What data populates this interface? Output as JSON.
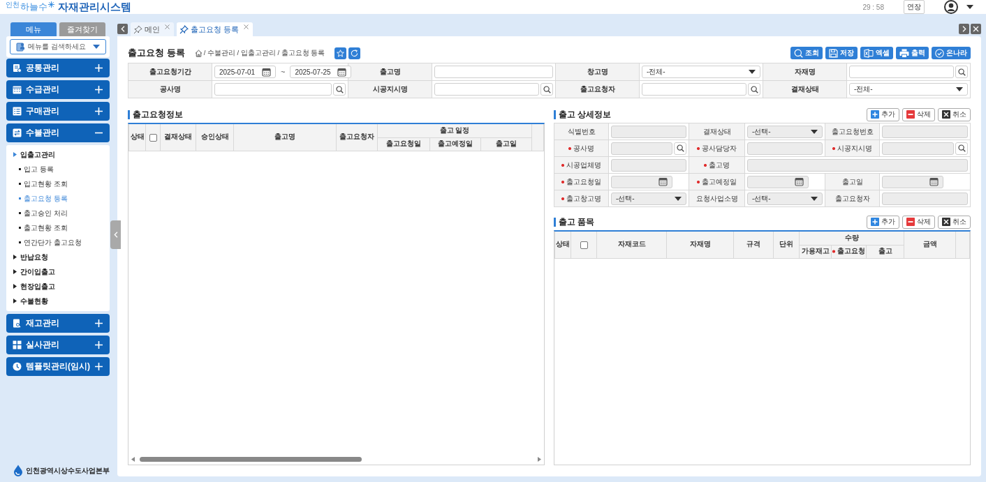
{
  "header": {
    "logo_prefix": "인천",
    "logo_brand": "하늘수",
    "system_title": "자재관리시스템",
    "timer": "29 : 58",
    "extend_button": "연장"
  },
  "sidebar": {
    "tabs": [
      {
        "label": "메뉴",
        "selected": true
      },
      {
        "label": "즐겨찾기",
        "selected": false
      }
    ],
    "search": {
      "placeholder": "메뉴를 검색하세요"
    },
    "menus": [
      {
        "label": "공통관리",
        "expanded": false
      },
      {
        "label": "수급관리",
        "expanded": false
      },
      {
        "label": "구매관리",
        "expanded": false
      },
      {
        "label": "수불관리",
        "expanded": true,
        "children": [
          {
            "label": "입출고관리",
            "expanded": true,
            "children": [
              {
                "label": "입고 등록",
                "selected": false
              },
              {
                "label": "입고현황 조회",
                "selected": false
              },
              {
                "label": "출고요청 등록",
                "selected": true
              },
              {
                "label": "출고승인 처리",
                "selected": false
              },
              {
                "label": "출고현황 조회",
                "selected": false
              },
              {
                "label": "연간단가 출고요청",
                "selected": false
              }
            ]
          },
          {
            "label": "반납요청",
            "expanded": false
          },
          {
            "label": "간이입출고",
            "expanded": false
          },
          {
            "label": "현장입출고",
            "expanded": false
          },
          {
            "label": "수불현황",
            "expanded": false
          }
        ]
      },
      {
        "label": "재고관리",
        "expanded": false
      },
      {
        "label": "실사관리",
        "expanded": false
      },
      {
        "label": "템플릿관리(임시)",
        "expanded": false
      }
    ],
    "footer": "인천광역시상수도사업본부"
  },
  "tabs": [
    {
      "label": "메인",
      "selected": false
    },
    {
      "label": "출고요청 등록",
      "selected": true
    }
  ],
  "page": {
    "title": "출고요청 등록",
    "breadcrumb": "/ 수불관리 / 입출고관리 / 출고요청 등록",
    "toolbar": [
      "조회",
      "저장",
      "엑셀",
      "출력",
      "온나라"
    ],
    "search_form": [
      [
        {
          "label": "출고요청기간",
          "kind": "date_range",
          "values": [
            "2025-07-01",
            "2025-07-25"
          ],
          "separator": "~"
        },
        {
          "label": "출고명",
          "kind": "text"
        },
        {
          "label": "창고명",
          "kind": "select",
          "value": "-전체-"
        },
        {
          "label": "자재명",
          "kind": "search"
        }
      ],
      [
        {
          "label": "공사명",
          "kind": "search"
        },
        {
          "label": "시공지시명",
          "kind": "search"
        },
        {
          "label": "출고요청자",
          "kind": "search"
        },
        {
          "label": "결재상태",
          "kind": "select",
          "value": "-전체-"
        }
      ]
    ],
    "request_grid": {
      "title": "출고요청정보",
      "columns": [
        {
          "kind": "text",
          "label": "상태"
        },
        {
          "kind": "checkbox",
          "checked": false
        },
        {
          "kind": "text",
          "label": "결재상태"
        },
        {
          "kind": "text",
          "label": "승인상태"
        },
        {
          "kind": "text",
          "label": "출고명"
        },
        {
          "kind": "text",
          "label": "출고요청자"
        },
        {
          "kind": "group",
          "label": "출고 일정",
          "children": [
            {
              "label": "출고요청일",
              "required": false
            },
            {
              "label": "출고예정일",
              "required": false
            },
            {
              "label": "출고일",
              "required": false
            }
          ]
        }
      ]
    },
    "detail": {
      "title": "출고 상세정보",
      "actions": [
        "추가",
        "삭제",
        "취소"
      ],
      "rows": [
        [
          {
            "label": "식별번호",
            "kind": "text",
            "required": false,
            "disabled": true
          },
          {
            "label": "결재상태",
            "kind": "select",
            "value": "-선택-",
            "required": false,
            "disabled": true
          },
          {
            "label": "출고요청번호",
            "kind": "text",
            "required": false,
            "disabled": true
          }
        ],
        [
          {
            "label": "공사명",
            "kind": "search",
            "required": true,
            "disabled": true
          },
          {
            "label": "공사담당자",
            "kind": "text",
            "required": true,
            "disabled": true
          },
          {
            "label": "시공지시명",
            "kind": "search",
            "required": true,
            "disabled": true
          }
        ],
        [
          {
            "label": "시공업체명",
            "kind": "text",
            "required": true,
            "disabled": true
          },
          {
            "label": "출고명",
            "kind": "text",
            "required": true,
            "disabled": true
          }
        ],
        [
          {
            "label": "출고요청일",
            "kind": "date",
            "required": true,
            "disabled": true
          },
          {
            "label": "출고예정일",
            "kind": "date",
            "required": true,
            "disabled": true
          },
          {
            "label": "출고일",
            "kind": "date",
            "required": false,
            "disabled": true
          }
        ],
        [
          {
            "label": "출고창고명",
            "kind": "select",
            "value": "-선택-",
            "required": true,
            "disabled": true
          },
          {
            "label": "요청사업소명",
            "kind": "select",
            "value": "-선택-",
            "required": false,
            "disabled": true
          },
          {
            "label": "출고요청자",
            "kind": "text",
            "required": false,
            "disabled": true
          }
        ]
      ]
    },
    "items_grid": {
      "title": "출고 품목",
      "actions": [
        "추가",
        "삭제",
        "취소"
      ],
      "columns": [
        {
          "kind": "text",
          "label": "상태"
        },
        {
          "kind": "checkbox",
          "checked": false
        },
        {
          "kind": "text",
          "label": "자재코드"
        },
        {
          "kind": "text",
          "label": "자재명"
        },
        {
          "kind": "text",
          "label": "규격"
        },
        {
          "kind": "text",
          "label": "단위"
        },
        {
          "kind": "group",
          "label": "수량",
          "children": [
            {
              "label": "가용재고",
              "required": false
            },
            {
              "label": "출고요청",
              "required": true
            },
            {
              "label": "출고",
              "required": false
            }
          ]
        },
        {
          "kind": "text",
          "label": "금액"
        }
      ]
    }
  }
}
